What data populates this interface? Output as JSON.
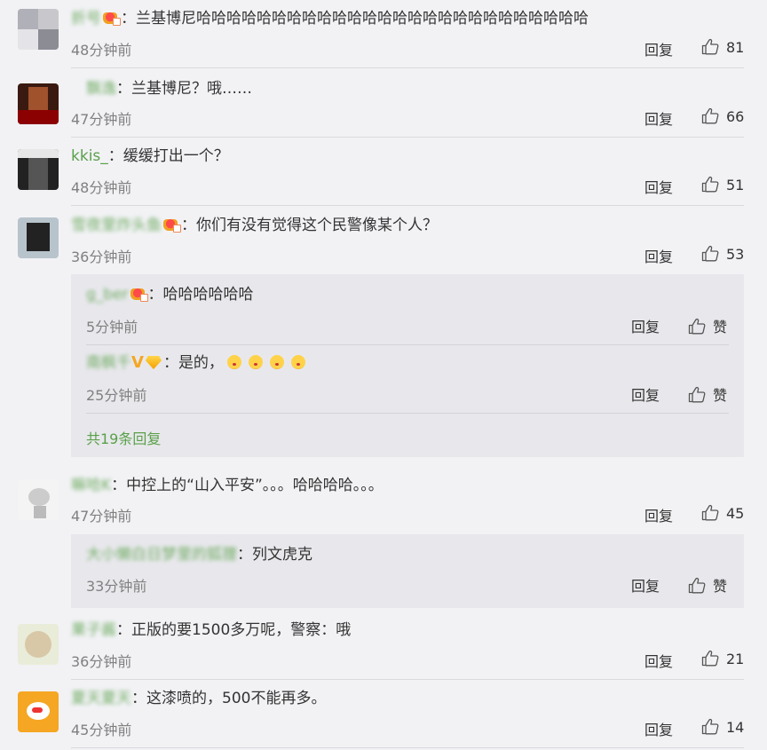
{
  "labels": {
    "reply": "回复",
    "like_zero": "赞",
    "colon": "："
  },
  "comments": [
    {
      "user": "折号",
      "text": "兰基博尼哈哈哈哈哈哈哈哈哈哈哈哈哈哈哈哈哈哈哈哈哈哈哈哈哈哈",
      "time": "48分钟前",
      "likes": "81"
    },
    {
      "user": "飘逸",
      "text": "兰基博尼？哦……",
      "time": "47分钟前",
      "likes": "66"
    },
    {
      "user": "kkis_",
      "text": "缓缓打出一个？",
      "time": "48分钟前",
      "likes": "51"
    },
    {
      "user": "雪夜里炸头鱼",
      "text": "你们有没有觉得这个民警像某个人？",
      "time": "36分钟前",
      "likes": "53",
      "replies": [
        {
          "user": "g_ber",
          "text": "哈哈哈哈哈哈",
          "time": "5分钟前"
        },
        {
          "user": "南枫千",
          "text": "是的，",
          "time": "25分钟前"
        }
      ],
      "more": "共19条回复"
    },
    {
      "user": "嘛哈K",
      "text": "中控上的“山入平安”。。。哈哈哈哈。。。",
      "time": "47分钟前",
      "likes": "45",
      "replies": [
        {
          "user": "大小懒白日梦里的狐狸",
          "text": "列文虎克",
          "time": "33分钟前"
        }
      ]
    },
    {
      "user": "果子酱",
      "text": "正版的要1500多万呢，警察：哦",
      "time": "36分钟前",
      "likes": "21"
    },
    {
      "user": "夏天夏天",
      "text": "这漆喷的，500不能再多。",
      "time": "45分钟前",
      "likes": "14"
    }
  ]
}
